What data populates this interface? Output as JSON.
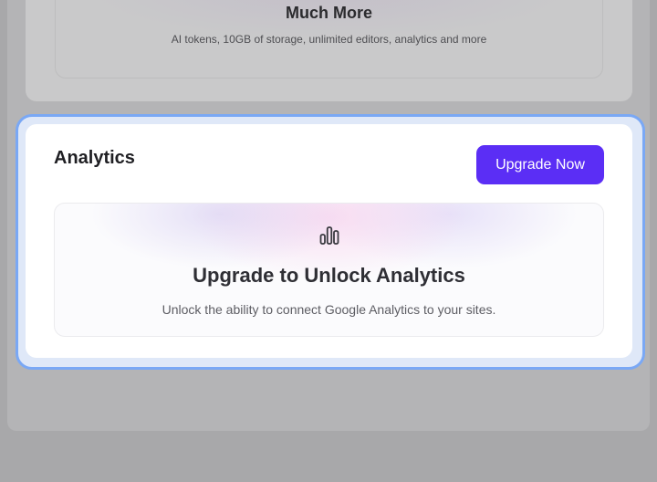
{
  "upgrade_card": {
    "title": "Much More",
    "description": "AI tokens, 10GB of storage, unlimited editors, analytics and more"
  },
  "analytics_card": {
    "title": "Analytics",
    "button_label": "Upgrade Now",
    "promo_title": "Upgrade to Unlock Analytics",
    "promo_description": "Unlock the ability to connect Google Analytics to your sites.",
    "icon": "bar-chart-icon"
  },
  "colors": {
    "accent": "#5b2ef5",
    "focus_ring": "#7aa8f5",
    "overlay": "#a8a8aa"
  }
}
